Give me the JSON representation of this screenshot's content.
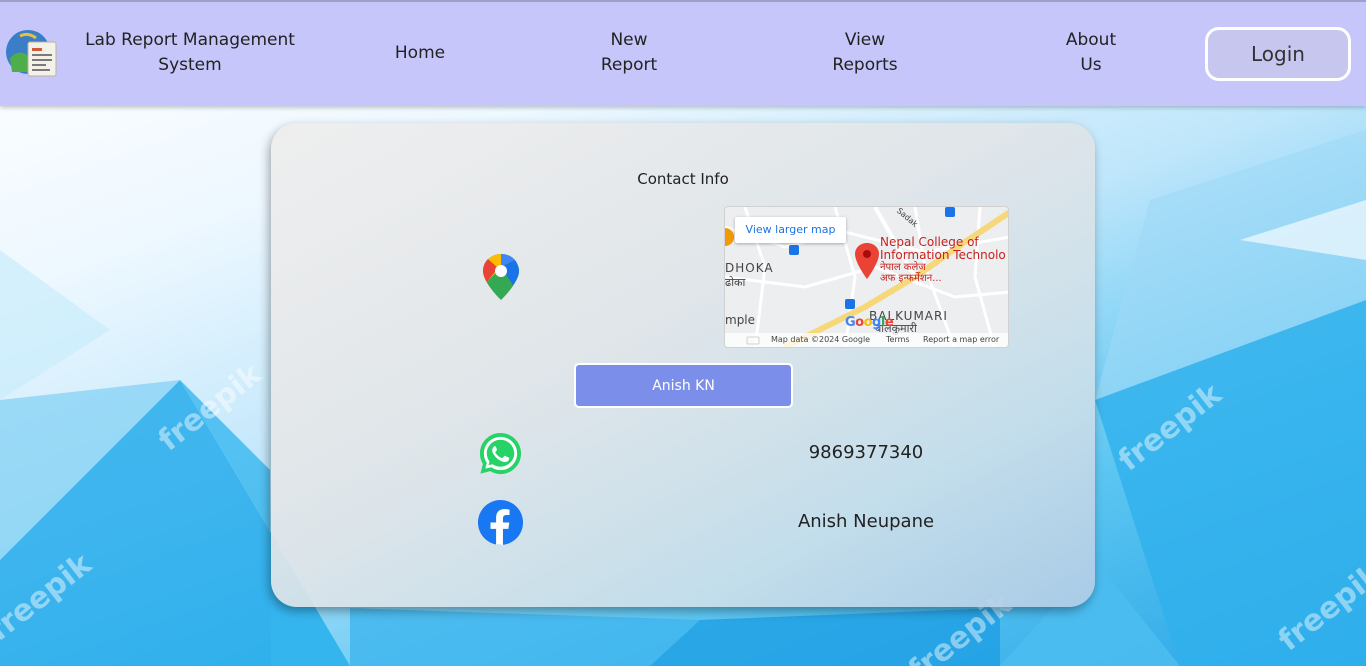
{
  "nav": {
    "brand_line1": "Lab Report Management",
    "brand_line2": "System",
    "home": "Home",
    "new_line1": "New",
    "new_line2": "Report",
    "view_line1": "View",
    "view_line2": "Reports",
    "about_line1": "About",
    "about_line2": "Us",
    "login": "Login"
  },
  "card": {
    "title": "Contact Info",
    "name_button": "Anish KN",
    "phone": "9869377340",
    "facebook_name": "Anish Neupane"
  },
  "map": {
    "view_larger": "View larger map",
    "place_line1": "Nepal College of",
    "place_line2": "Information Technolo",
    "place_np1": "नेपाल कलेज",
    "place_np2": "अफ इन्फर्मेशन...",
    "area1": "DHOKA",
    "area1_np": "ढोका",
    "area2": "BALKUMARI",
    "area2_np": "बालकुमारी",
    "area3": "mple",
    "road": "Sadak",
    "footer_data": "Map data ©2024 Google",
    "footer_terms": "Terms",
    "footer_report": "Report a map error"
  },
  "watermark": "freepik",
  "icons": {
    "logo": "lab-report-logo-icon",
    "maps": "google-maps-pin-icon",
    "whatsapp": "whatsapp-icon",
    "facebook": "facebook-icon",
    "keyboard": "keyboard-icon"
  },
  "colors": {
    "navbar": "#c6c6fb",
    "name_button": "#7b8fea",
    "whatsapp": "#25d366",
    "facebook": "#1877f2"
  }
}
